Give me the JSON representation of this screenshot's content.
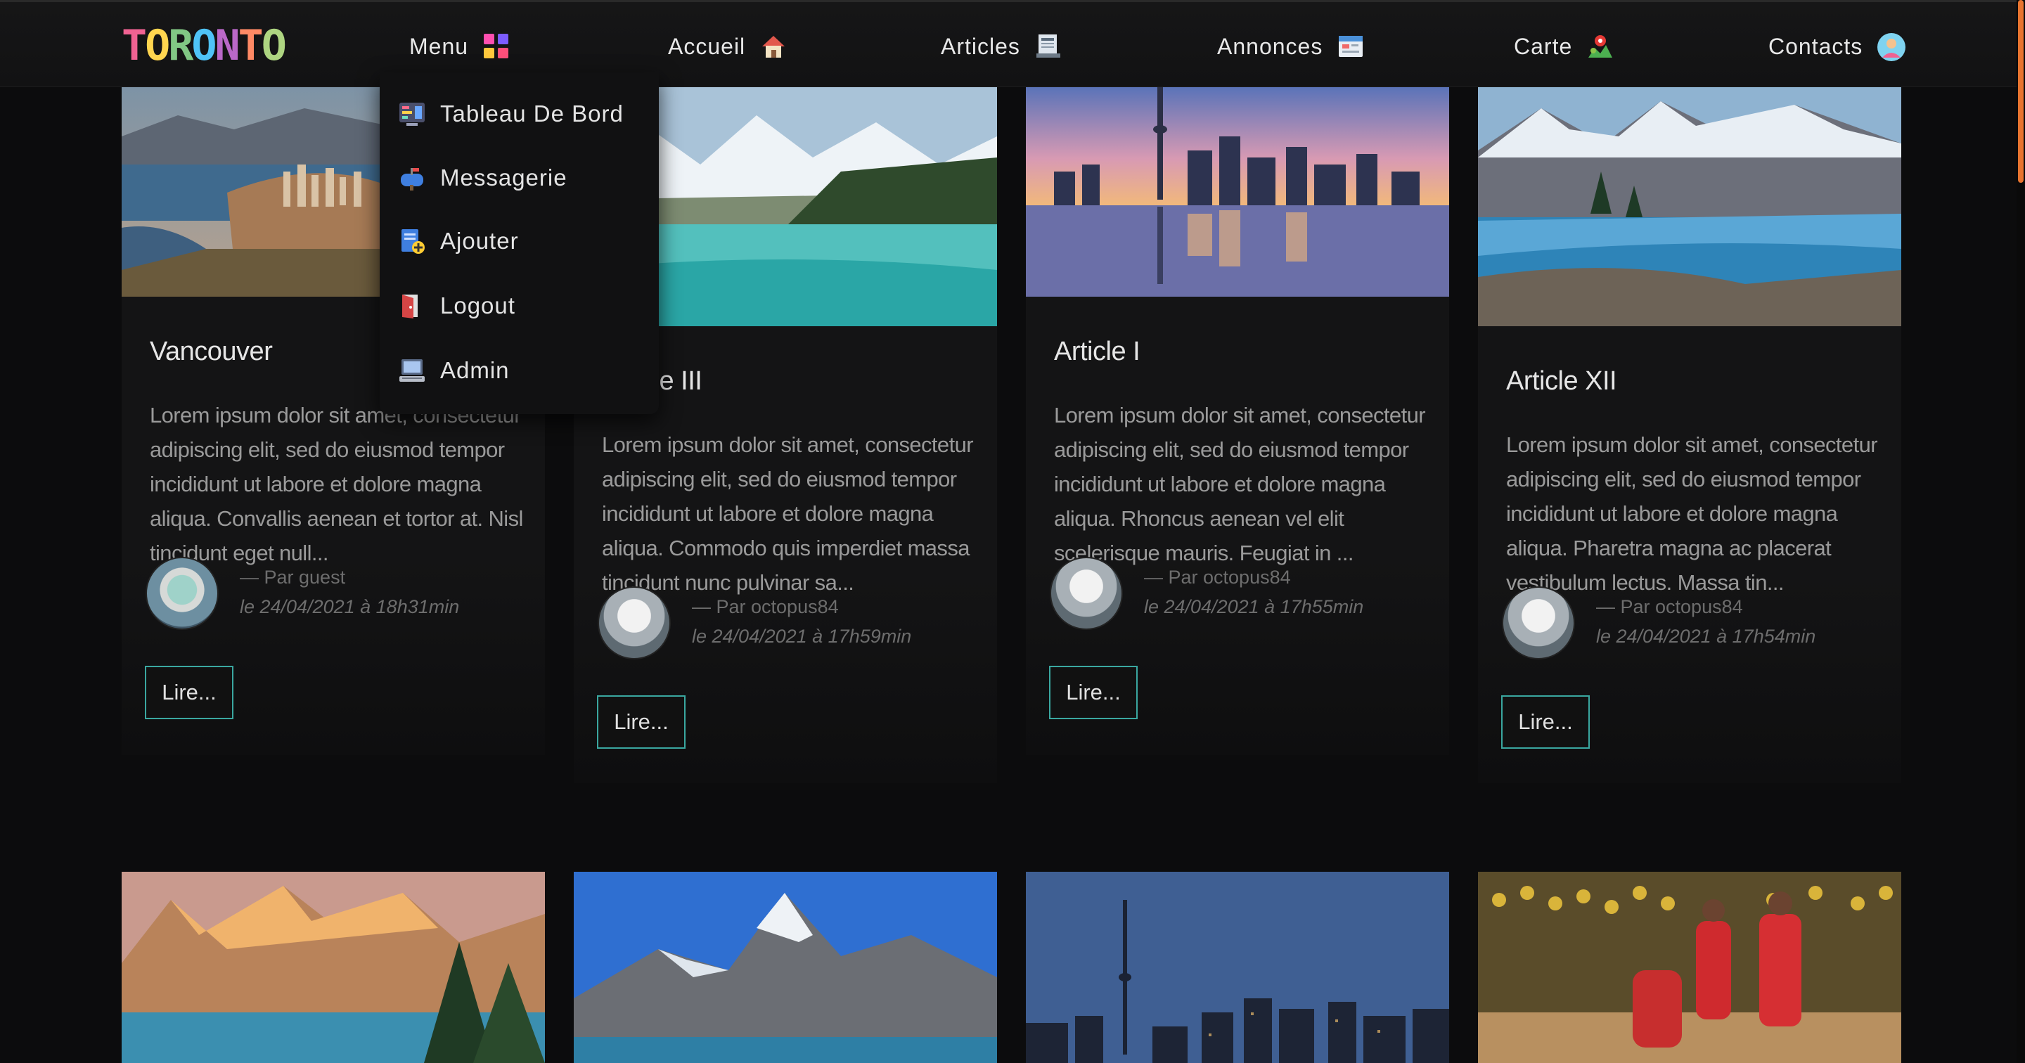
{
  "header": {
    "logo": "TORONTO",
    "logo_colors": [
      "#f06292",
      "#ffd54f",
      "#81c784",
      "#4fc3f7",
      "#ba68c8",
      "#ff8a65",
      "#aed581"
    ],
    "nav": [
      {
        "label": "Menu",
        "icon": "grid-icon"
      },
      {
        "label": "Accueil",
        "icon": "home-icon"
      },
      {
        "label": "Articles",
        "icon": "newspaper-icon"
      },
      {
        "label": "Annonces",
        "icon": "calendar-icon"
      },
      {
        "label": "Carte",
        "icon": "map-icon"
      },
      {
        "label": "Contacts",
        "icon": "contact-avatar-icon"
      }
    ]
  },
  "dropdown": {
    "items": [
      {
        "label": "Tableau De Bord",
        "icon": "dashboard-icon"
      },
      {
        "label": "Messagerie",
        "icon": "mailbox-icon"
      },
      {
        "label": "Ajouter",
        "icon": "add-document-icon"
      },
      {
        "label": "Logout",
        "icon": "logout-door-icon"
      },
      {
        "label": "Admin",
        "icon": "admin-computer-icon"
      }
    ]
  },
  "cards": [
    {
      "title": "Vancouver",
      "excerpt": "Lorem ipsum dolor sit amet, consectetur adipiscing elit, sed do eiusmod tempor incididunt ut labore et dolore magna aliqua. Convallis aenean et tortor at. Nisl tincidunt eget null...",
      "author": "— Par guest",
      "date": "le 24/04/2021 à 18h31min",
      "button": "Lire..."
    },
    {
      "title": "Article III",
      "excerpt": "Lorem ipsum dolor sit amet, consectetur adipiscing elit, sed do eiusmod tempor incididunt ut labore et dolore magna aliqua. Commodo quis imperdiet massa tincidunt nunc pulvinar sa...",
      "author": "— Par octopus84",
      "date": "le 24/04/2021 à 17h59min",
      "button": "Lire..."
    },
    {
      "title": "Article I",
      "excerpt": "Lorem ipsum dolor sit amet, consectetur adipiscing elit, sed do eiusmod tempor incididunt ut labore et dolore magna aliqua. Rhoncus aenean vel elit scelerisque mauris. Feugiat in ...",
      "author": "— Par octopus84",
      "date": "le 24/04/2021 à 17h55min",
      "button": "Lire..."
    },
    {
      "title": "Article XII",
      "excerpt": "Lorem ipsum dolor sit amet, consectetur adipiscing elit, sed do eiusmod tempor incididunt ut labore et dolore magna aliqua. Pharetra magna ac placerat vestibulum lectus. Massa tin...",
      "author": "— Par octopus84",
      "date": "le 24/04/2021 à 17h54min",
      "button": "Lire..."
    }
  ],
  "accent_color": "#3aa7a0",
  "scroll_accent": "#e8742f"
}
